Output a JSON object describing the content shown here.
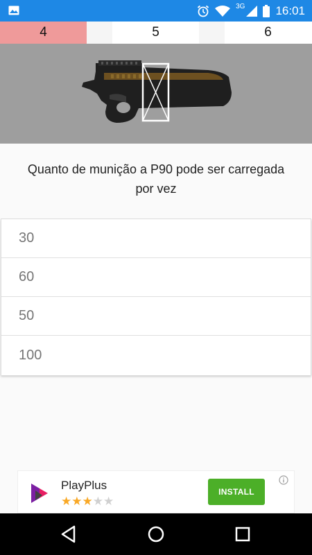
{
  "status_bar": {
    "time": "16:01",
    "network": "3G",
    "icons": [
      "gallery-icon",
      "alarm-icon",
      "wifi-icon",
      "signal-icon",
      "battery-icon"
    ]
  },
  "tabs": [
    {
      "label": "4",
      "active": true
    },
    {
      "label": "5",
      "active": false
    },
    {
      "label": "6",
      "active": false
    }
  ],
  "question": {
    "text": "Quanto de munição a P90 pode ser carregada por vez"
  },
  "answers": [
    {
      "label": "30"
    },
    {
      "label": "60"
    },
    {
      "label": "50"
    },
    {
      "label": "100"
    }
  ],
  "ad": {
    "app_name": "PlayPlus",
    "rating": 3,
    "max_rating": 5,
    "install_label": "INSTALL",
    "install_color": "#4caf28"
  },
  "nav_bar": {
    "icons": [
      "back-icon",
      "home-icon",
      "recents-icon"
    ]
  },
  "colors": {
    "status_bar": "#1e88e5",
    "active_tab": "#ef9a9a",
    "image_background": "#9e9e9e"
  }
}
